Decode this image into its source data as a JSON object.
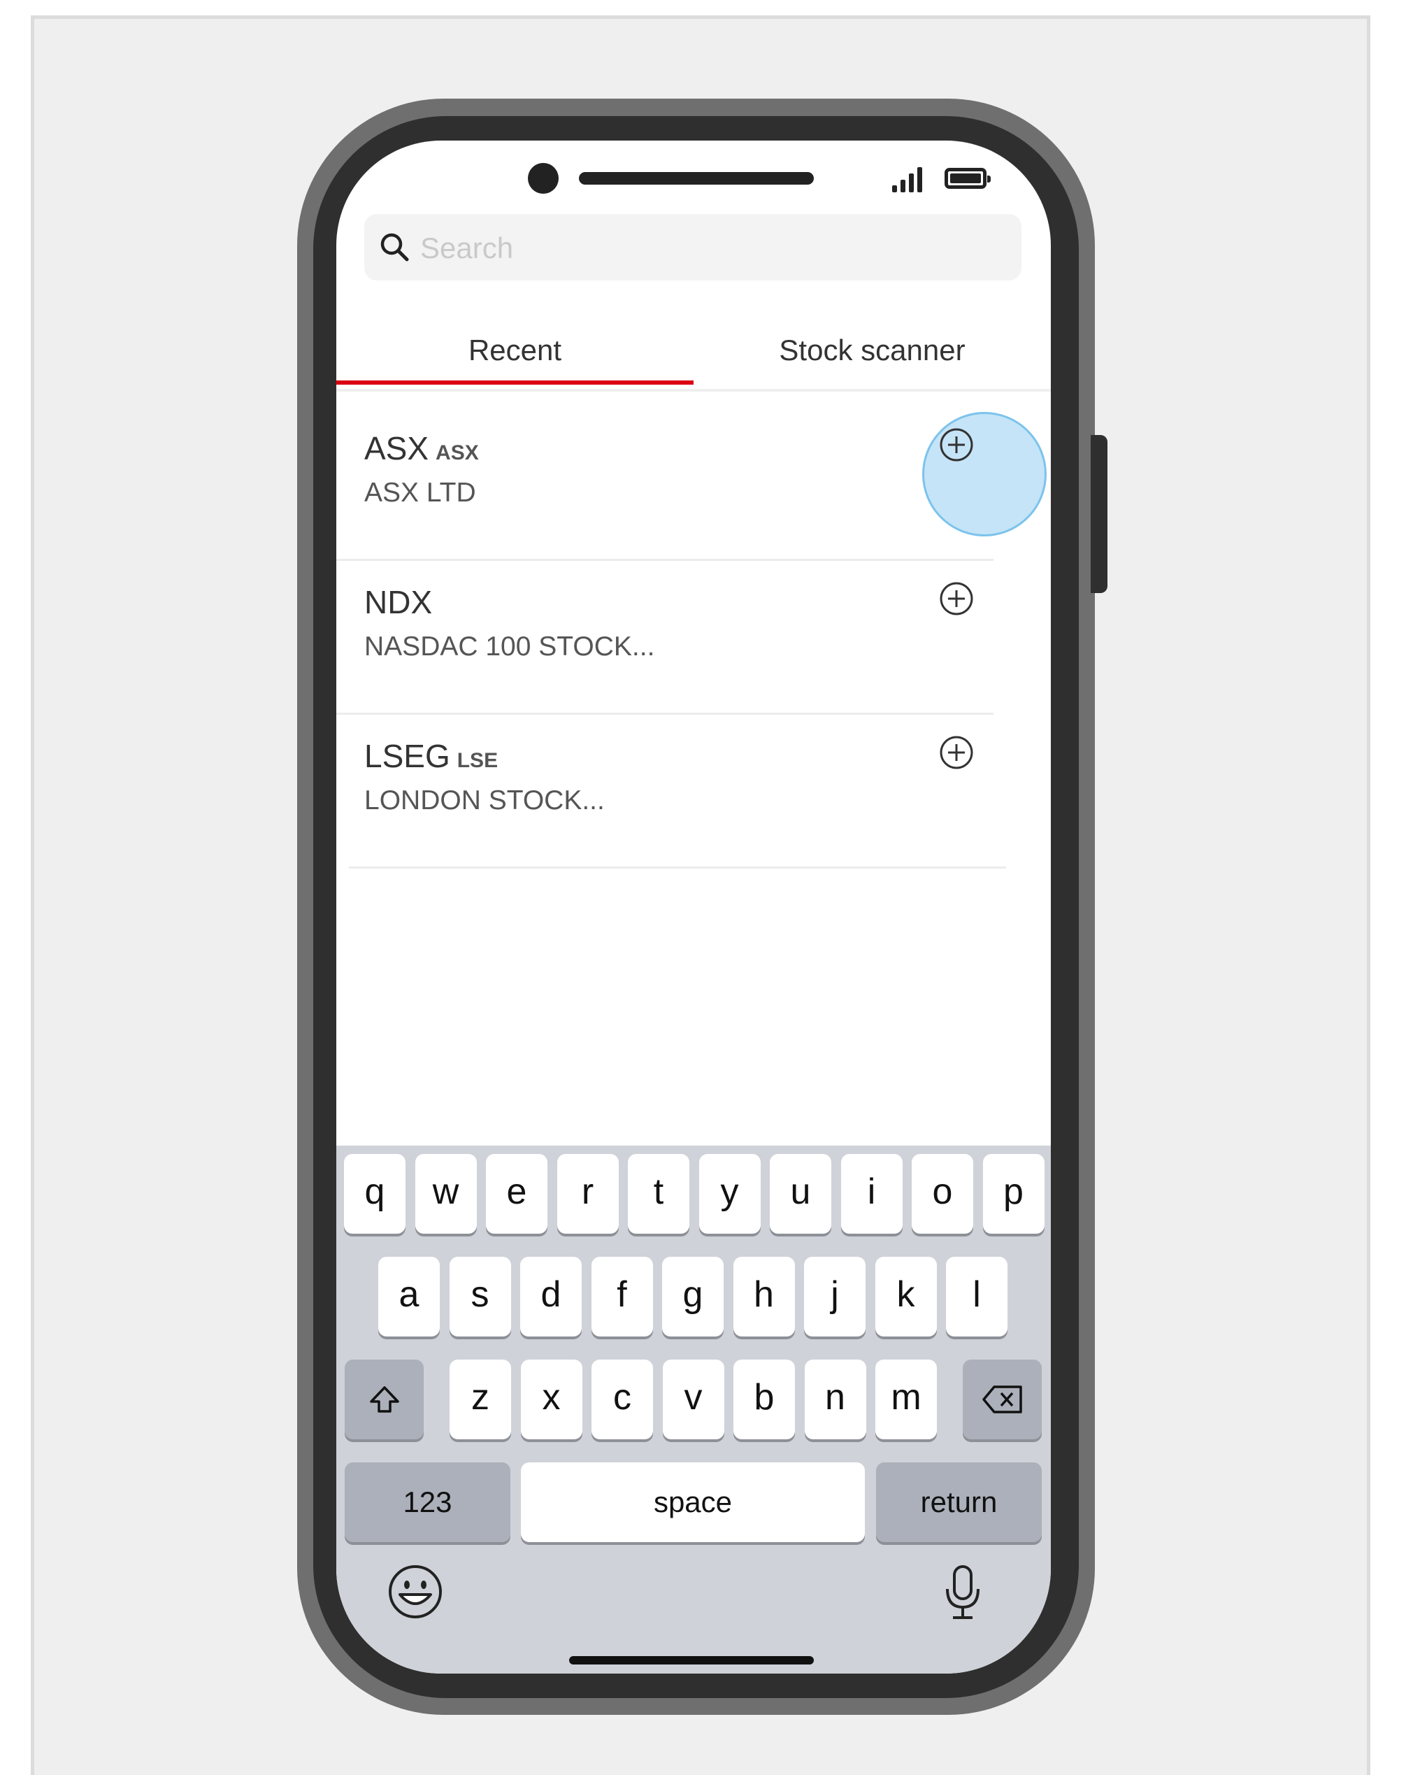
{
  "status_bar": {
    "signal_icon": "cellular-signal-icon",
    "battery_icon": "battery-full-icon"
  },
  "search": {
    "placeholder": "Search",
    "value": "",
    "icon": "search-icon"
  },
  "tabs": [
    {
      "label": "Recent",
      "active": true
    },
    {
      "label": "Stock scanner",
      "active": false
    }
  ],
  "colors": {
    "accent": "#db0011",
    "tap_highlight": "#96cdf0"
  },
  "recent_items": [
    {
      "symbol": "ASX",
      "exchange": "ASX",
      "name": "ASX LTD",
      "action_icon": "add-circle-icon"
    },
    {
      "symbol": "NDX",
      "exchange": "",
      "name": "NASDAC 100 STOCK...",
      "action_icon": "add-circle-icon"
    },
    {
      "symbol": "LSEG",
      "exchange": "LSE",
      "name": "LONDON STOCK...",
      "action_icon": "add-circle-icon"
    }
  ],
  "keyboard": {
    "row1": [
      "q",
      "w",
      "e",
      "r",
      "t",
      "y",
      "u",
      "i",
      "o",
      "p"
    ],
    "row2": [
      "a",
      "s",
      "d",
      "f",
      "g",
      "h",
      "j",
      "k",
      "l"
    ],
    "row3": [
      "z",
      "x",
      "c",
      "v",
      "b",
      "n",
      "m"
    ],
    "shift_icon": "shift-icon",
    "backspace_icon": "backspace-icon",
    "numbers_label": "123",
    "space_label": "space",
    "return_label": "return",
    "emoji_icon": "emoji-icon",
    "mic_icon": "microphone-icon"
  }
}
